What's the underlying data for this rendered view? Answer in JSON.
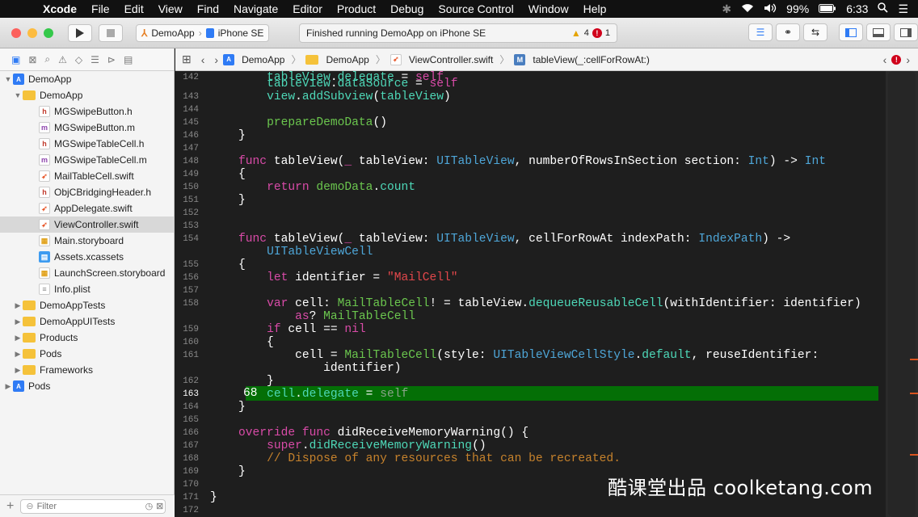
{
  "menubar": {
    "apple": "",
    "items": [
      "Xcode",
      "File",
      "Edit",
      "View",
      "Find",
      "Navigate",
      "Editor",
      "Product",
      "Debug",
      "Source Control",
      "Window",
      "Help"
    ],
    "battery": "99%",
    "clock": "6:33"
  },
  "toolbar": {
    "scheme_target": "DemoApp",
    "scheme_device": "iPhone SE",
    "activity_text": "Finished running DemoApp on iPhone SE",
    "warning_count": "4",
    "error_count": "1"
  },
  "navigator": {
    "items": [
      {
        "label": "DemoApp",
        "icon": "project-icon"
      },
      {
        "label": "DemoApp",
        "icon": "folder-icon"
      },
      {
        "label": "MGSwipeButton.h",
        "icon": "header-file-icon"
      },
      {
        "label": "MGSwipeButton.m",
        "icon": "objc-file-icon"
      },
      {
        "label": "MGSwipeTableCell.h",
        "icon": "header-file-icon"
      },
      {
        "label": "MGSwipeTableCell.m",
        "icon": "objc-file-icon"
      },
      {
        "label": "MailTableCell.swift",
        "icon": "swift-file-icon"
      },
      {
        "label": "ObjCBridgingHeader.h",
        "icon": "header-file-icon"
      },
      {
        "label": "AppDelegate.swift",
        "icon": "swift-file-icon"
      },
      {
        "label": "ViewController.swift",
        "icon": "swift-file-icon"
      },
      {
        "label": "Main.storyboard",
        "icon": "storyboard-icon"
      },
      {
        "label": "Assets.xcassets",
        "icon": "assets-icon"
      },
      {
        "label": "LaunchScreen.storyboard",
        "icon": "storyboard-icon"
      },
      {
        "label": "Info.plist",
        "icon": "plist-icon"
      },
      {
        "label": "DemoAppTests",
        "icon": "folder-icon"
      },
      {
        "label": "DemoAppUITests",
        "icon": "folder-icon"
      },
      {
        "label": "Products",
        "icon": "folder-icon"
      },
      {
        "label": "Pods",
        "icon": "folder-icon"
      },
      {
        "label": "Frameworks",
        "icon": "folder-icon"
      },
      {
        "label": "Pods",
        "icon": "project-icon"
      }
    ],
    "filter_placeholder": "Filter"
  },
  "jumpbar": {
    "crumbs": [
      "DemoApp",
      "DemoApp",
      "ViewController.swift",
      "tableView(_:cellForRowAt:)"
    ]
  },
  "editor": {
    "line_numbers": [
      "142",
      "143",
      "144",
      "145",
      "146",
      "147",
      "148",
      "149",
      "150",
      "151",
      "152",
      "153",
      "154",
      "",
      "155",
      "156",
      "157",
      "158",
      "",
      "159",
      "160",
      "161",
      "",
      "162",
      "163",
      "164",
      "165",
      "166",
      "167",
      "168",
      "169",
      "170",
      "171",
      "172"
    ],
    "current_line_badge": "68"
  },
  "watermark": "酷课堂出品 coolketang.com"
}
